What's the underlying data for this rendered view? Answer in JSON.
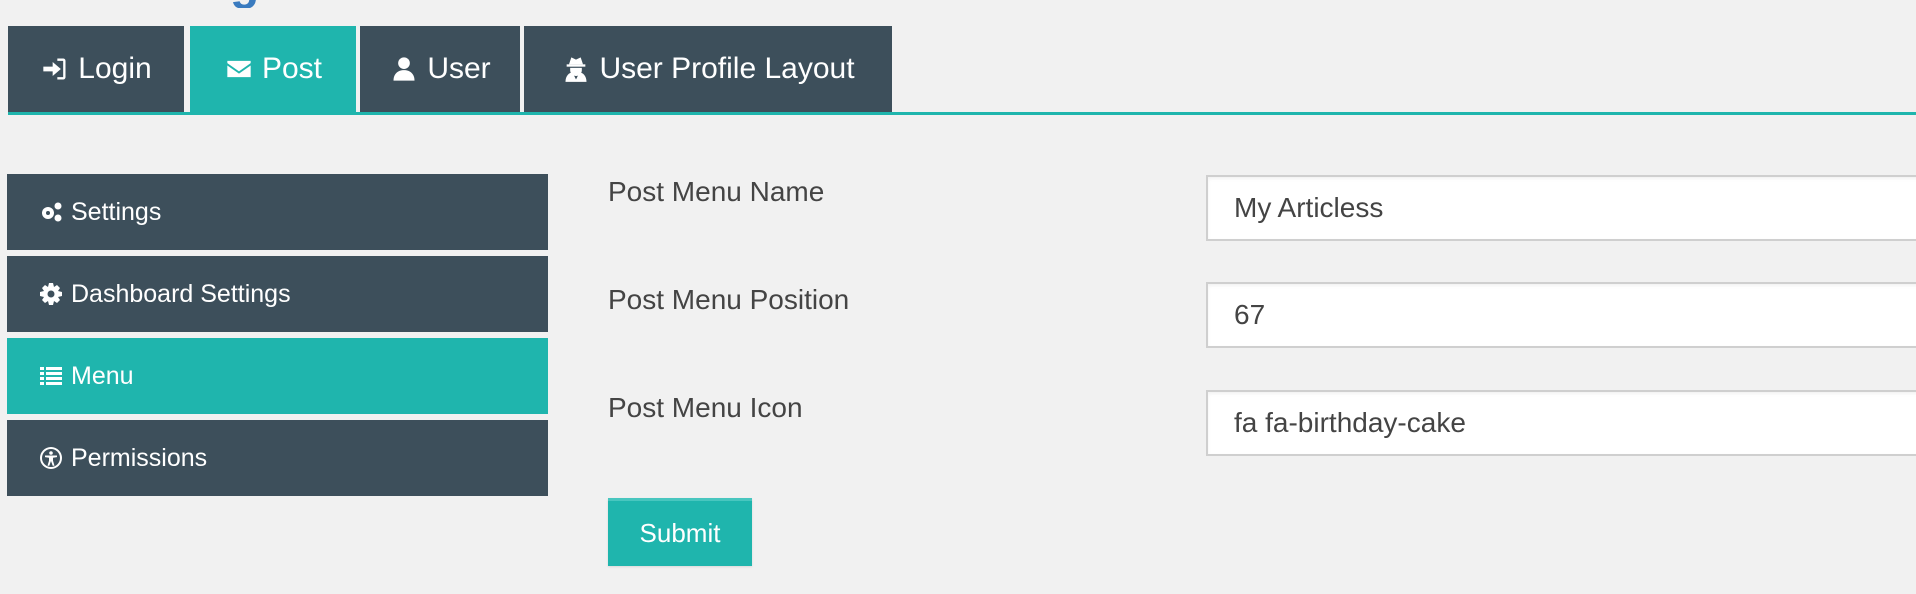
{
  "header": {
    "title_partial": "g"
  },
  "tabs": [
    {
      "label": "Login",
      "icon": "sign-in-icon",
      "active": false
    },
    {
      "label": "Post",
      "icon": "envelope-icon",
      "active": true
    },
    {
      "label": "User",
      "icon": "user-icon",
      "active": false
    },
    {
      "label": "User Profile Layout",
      "icon": "user-secret-icon",
      "active": false
    }
  ],
  "sidebar": {
    "items": [
      {
        "label": "Settings",
        "icon": "cogs-icon",
        "active": false
      },
      {
        "label": "Dashboard Settings",
        "icon": "cog-icon",
        "active": false
      },
      {
        "label": "Menu",
        "icon": "list-icon",
        "active": true
      },
      {
        "label": "Permissions",
        "icon": "universal-access-icon",
        "active": false
      }
    ]
  },
  "form": {
    "fields": [
      {
        "label": "Post Menu Name",
        "value": "My Articless"
      },
      {
        "label": "Post Menu Position",
        "value": "67"
      },
      {
        "label": "Post Menu Icon",
        "value": "fa fa-birthday-cake"
      }
    ],
    "submit_label": "Submit"
  },
  "colors": {
    "dark": "#3d4f5b",
    "accent": "#1fb5ad",
    "title": "#3a7bbf",
    "background": "#f1f1f1"
  }
}
